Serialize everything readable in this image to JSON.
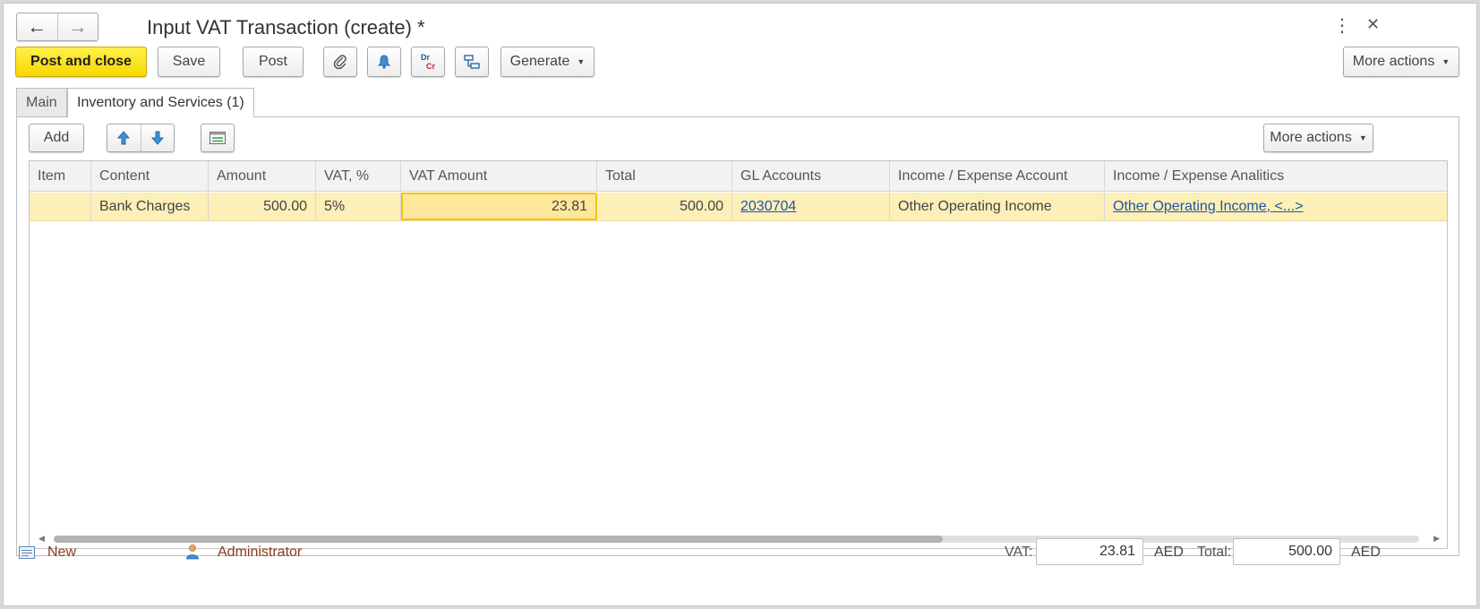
{
  "window": {
    "title": "Input VAT Transaction (create) *"
  },
  "nav": {
    "back_icon": "arrow-left-icon",
    "forward_icon": "arrow-right-icon"
  },
  "window_controls": {
    "menu_icon": "kebab-menu-icon",
    "close_icon": "close-icon"
  },
  "toolbar": {
    "post_and_close": "Post and close",
    "save": "Save",
    "post": "Post",
    "attach_icon": "paperclip-icon",
    "reminder_icon": "bell-icon",
    "drcr_dr": "Dr",
    "drcr_cr": "Cr",
    "structure_icon": "document-structure-icon",
    "generate": "Generate",
    "more_actions": "More actions"
  },
  "tabs": [
    {
      "label": "Main"
    },
    {
      "label": "Inventory and Services (1)"
    }
  ],
  "table_toolbar": {
    "add": "Add",
    "move_up_icon": "arrow-up-icon",
    "move_down_icon": "arrow-down-icon",
    "select_icon": "pick-from-list-icon",
    "more_actions": "More actions"
  },
  "table": {
    "columns": [
      "Item",
      "Content",
      "Amount",
      "VAT, %",
      "VAT Amount",
      "Total",
      "GL Accounts",
      "Income / Expense Account",
      "Income / Expense Analitics"
    ],
    "rows": [
      {
        "item": "",
        "content": "Bank Charges",
        "amount": "500.00",
        "vat_rate": "5%",
        "vat_amount": "23.81",
        "total": "500.00",
        "gl_account": "2030704",
        "income_expense_account": "Other Operating Income",
        "income_expense_analytics": "Other Operating Income, <...>"
      }
    ]
  },
  "footer": {
    "status_icon": "document-status-icon",
    "status": "New",
    "user_icon": "user-icon",
    "user": "Administrator",
    "vat_label": "VAT:",
    "vat_value": "23.81",
    "vat_currency": "AED",
    "total_label": "Total:",
    "total_value": "500.00",
    "total_currency": "AED"
  },
  "colors": {
    "primary_button": "#f7d800",
    "selected_row": "#fcefb8",
    "link": "#1f55a8",
    "footer_text": "#8c3a1a"
  }
}
